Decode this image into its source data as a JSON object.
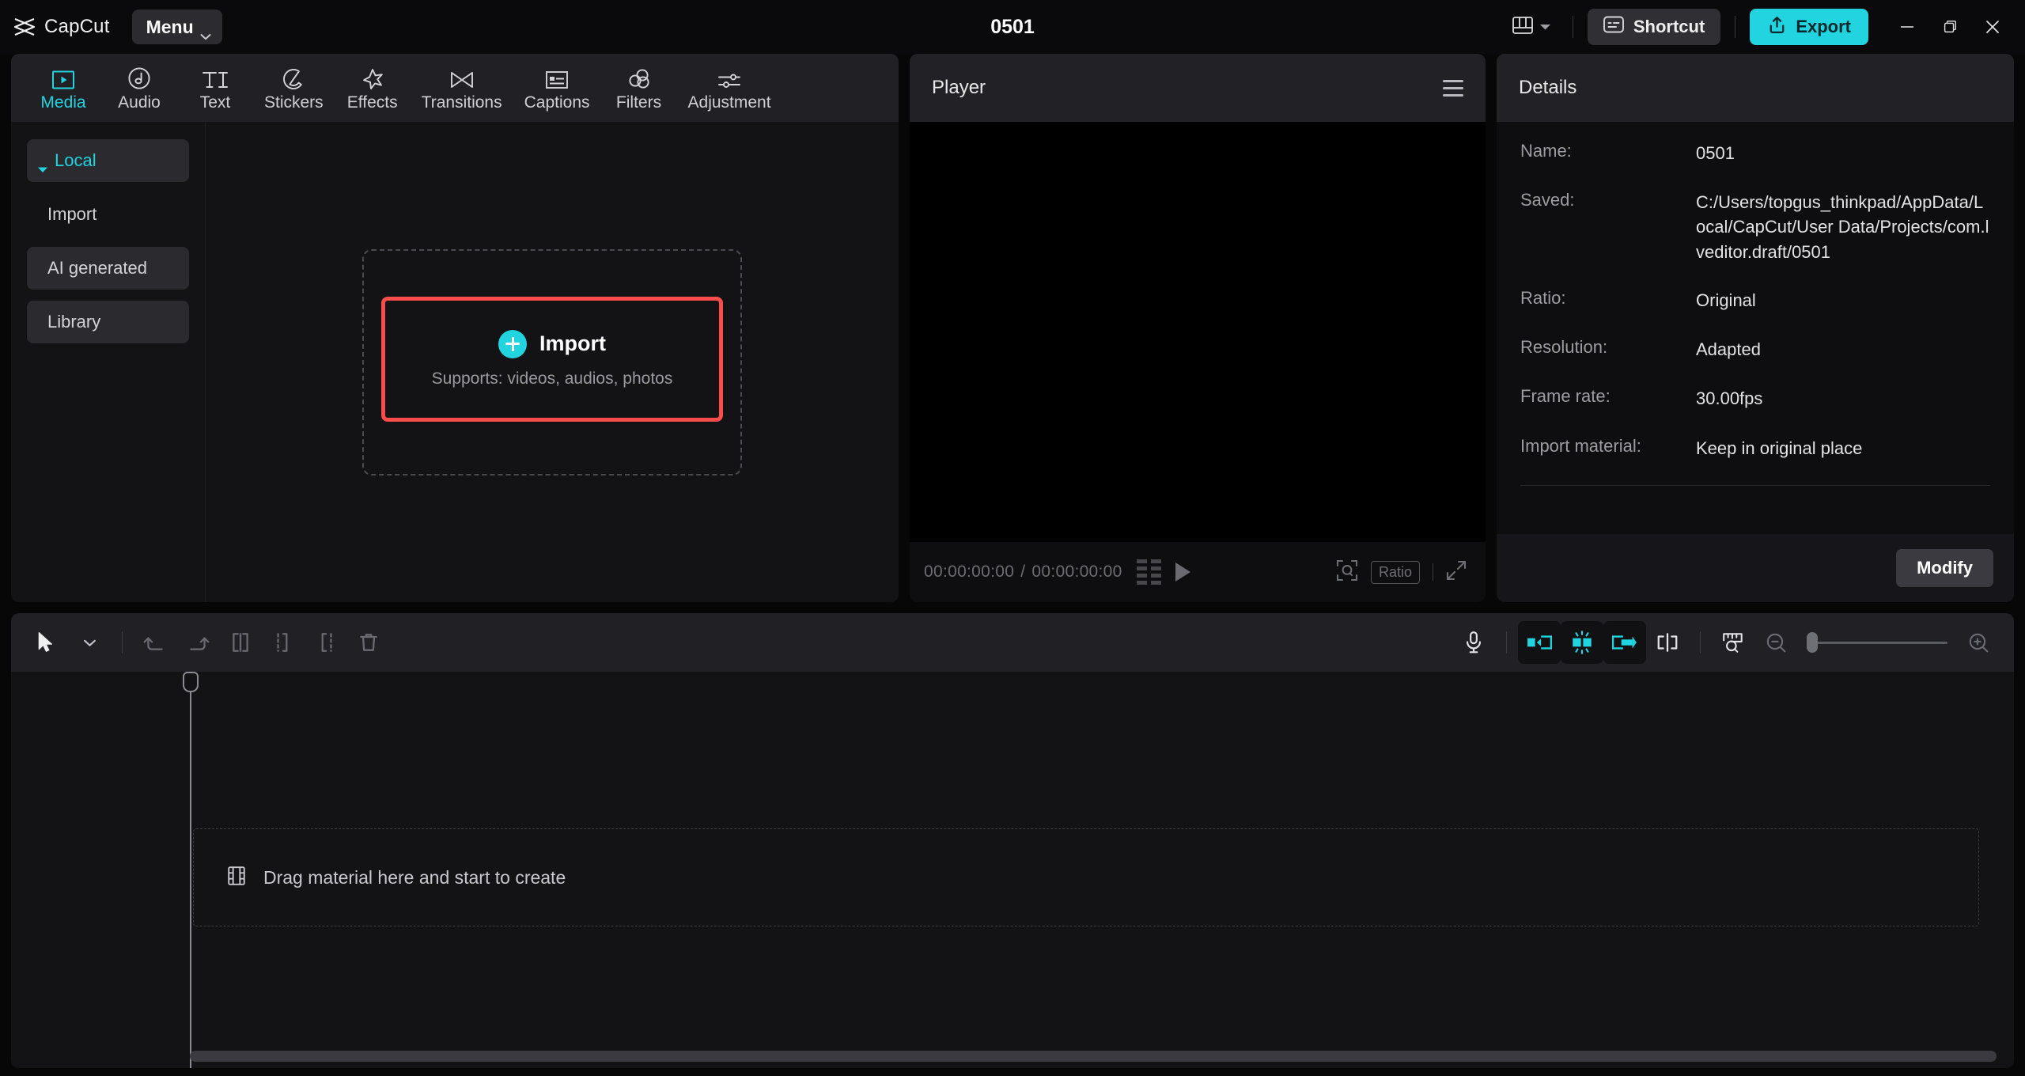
{
  "titlebar": {
    "brand_name": "CapCut",
    "brand_logo_icon": "capcut-logo-icon",
    "menu_label": "Menu",
    "menu_caret_icon": "chevron-down-icon",
    "project_title": "0501",
    "layout_icon": "layout-panels-icon",
    "layout_caret_icon": "chevron-down-icon",
    "shortcut_label": "Shortcut",
    "shortcut_icon": "keyboard-icon",
    "export_label": "Export",
    "export_icon": "upload-icon",
    "minimize_icon": "minimize-icon",
    "maximize_icon": "restore-icon",
    "close_icon": "close-icon",
    "accent_color": "#22d3e0"
  },
  "tabs": [
    {
      "label": "Media",
      "icon": "media-play-frame-icon",
      "active": true
    },
    {
      "label": "Audio",
      "icon": "music-note-icon",
      "active": false
    },
    {
      "label": "Text",
      "icon": "text-ti-icon",
      "active": false
    },
    {
      "label": "Stickers",
      "icon": "sticker-peel-icon",
      "active": false
    },
    {
      "label": "Effects",
      "icon": "sparkle-star-icon",
      "active": false
    },
    {
      "label": "Transitions",
      "icon": "transition-bowtie-icon",
      "active": false
    },
    {
      "label": "Captions",
      "icon": "captions-box-icon",
      "active": false
    },
    {
      "label": "Filters",
      "icon": "filters-circles-icon",
      "active": false
    },
    {
      "label": "Adjustment",
      "icon": "sliders-icon",
      "active": false
    }
  ],
  "media_sidebar": {
    "items": [
      {
        "label": "Local",
        "style": "group",
        "selected": true,
        "caret_icon": "triangle-down-icon"
      },
      {
        "label": "Import",
        "style": "plain",
        "selected": false
      },
      {
        "label": "AI generated",
        "style": "boxed",
        "selected": false
      },
      {
        "label": "Library",
        "style": "boxed",
        "selected": false
      }
    ]
  },
  "media_main": {
    "import_label": "Import",
    "import_sublabel": "Supports: videos, audios, photos",
    "plus_icon": "plus-circle-icon",
    "highlight_color": "#fb4c4c"
  },
  "player": {
    "title": "Player",
    "menu_icon": "hamburger-icon",
    "current_time": "00:00:00:00",
    "time_separator": "/",
    "total_time": "00:00:00:00",
    "grid_icon": "storyboard-grid-icon",
    "play_icon": "play-icon",
    "crop_icon": "crop-focus-icon",
    "ratio_label": "Ratio",
    "fullscreen_icon": "fullscreen-expand-icon"
  },
  "details": {
    "title": "Details",
    "rows": [
      {
        "label": "Name:",
        "value": "0501"
      },
      {
        "label": "Saved:",
        "value": "C:/Users/topgus_thinkpad/AppData/Local/CapCut/User Data/Projects/com.lveditor.draft/0501"
      },
      {
        "label": "Ratio:",
        "value": "Original"
      },
      {
        "label": "Resolution:",
        "value": "Adapted"
      },
      {
        "label": "Frame rate:",
        "value": "30.00fps"
      },
      {
        "label": "Import material:",
        "value": "Keep in original place"
      }
    ],
    "modify_label": "Modify"
  },
  "timeline": {
    "tools_left": [
      {
        "name": "select-cursor-tool",
        "icon": "cursor-arrow-icon",
        "enabled": true
      },
      {
        "name": "tool-dropdown",
        "icon": "chevron-down-icon",
        "enabled": true
      },
      {
        "name": "undo-button",
        "icon": "undo-arrow-icon",
        "enabled": false
      },
      {
        "name": "redo-button",
        "icon": "redo-arrow-icon",
        "enabled": false
      },
      {
        "name": "split-button",
        "icon": "split-clip-icon",
        "enabled": false
      },
      {
        "name": "delete-left-button",
        "icon": "trim-left-icon",
        "enabled": false
      },
      {
        "name": "delete-right-button",
        "icon": "trim-right-icon",
        "enabled": false
      },
      {
        "name": "delete-button",
        "icon": "trash-icon",
        "enabled": false
      }
    ],
    "tools_right": [
      {
        "name": "record-voiceover-button",
        "icon": "microphone-icon",
        "active": false
      },
      {
        "name": "auto-cut-start-button",
        "icon": "clip-snap-left-icon",
        "active": true
      },
      {
        "name": "auto-reframe-button",
        "icon": "clip-split-glow-icon",
        "active": true
      },
      {
        "name": "auto-cut-end-button",
        "icon": "clip-snap-right-icon",
        "active": true
      },
      {
        "name": "snap-toggle-button",
        "icon": "magnet-snap-icon",
        "active": false
      },
      {
        "name": "timeline-ruler-button",
        "icon": "ruler-zoom-icon",
        "active": false
      }
    ],
    "zoom_out_icon": "zoom-out-icon",
    "zoom_in_icon": "zoom-in-icon",
    "zoom_value": 0,
    "drop_hint": "Drag material here and start to create",
    "drop_icon": "film-strip-icon",
    "playhead_position": "00:00:00:00"
  }
}
